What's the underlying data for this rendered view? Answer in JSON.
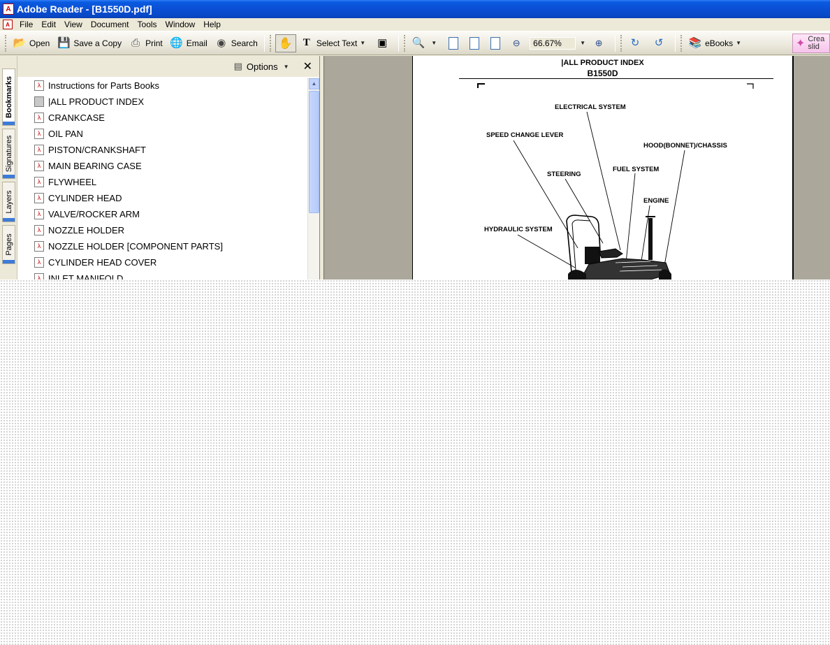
{
  "window": {
    "title": "Adobe Reader - [B1550D.pdf]"
  },
  "menu": [
    "File",
    "Edit",
    "View",
    "Document",
    "Tools",
    "Window",
    "Help"
  ],
  "toolbar": {
    "open": "Open",
    "save_copy": "Save a Copy",
    "print": "Print",
    "email": "Email",
    "search": "Search",
    "select_text": "Select Text",
    "zoom": "66.67%",
    "ebooks": "eBooks",
    "create_line1": "Crea",
    "create_line2": "slid"
  },
  "side_tabs": [
    "Bookmarks",
    "Signatures",
    "Layers",
    "Pages"
  ],
  "bookmarks": {
    "options_label": "Options",
    "items": [
      "Instructions for Parts Books",
      "|ALL PRODUCT INDEX",
      "CRANKCASE",
      "OIL PAN",
      "PISTON/CRANKSHAFT",
      "MAIN BEARING CASE",
      "FLYWHEEL",
      "CYLINDER HEAD",
      "VALVE/ROCKER ARM",
      "NOZZLE HOLDER",
      "NOZZLE HOLDER [COMPONENT PARTS]",
      "CYLINDER HEAD COVER",
      "INLET MANIFOLD"
    ]
  },
  "document": {
    "title": "|ALL PRODUCT INDEX",
    "model": "B1550D",
    "labels": {
      "electrical": "ELECTRICAL SYSTEM",
      "speed_change": "SPEED CHANGE LEVER",
      "hood": "HOOD(BONNET)/CHASSIS",
      "steering": "STEERING",
      "fuel": "FUEL SYSTEM",
      "engine": "ENGINE",
      "hydraulic": "HYDRAULIC SYSTEM"
    }
  }
}
